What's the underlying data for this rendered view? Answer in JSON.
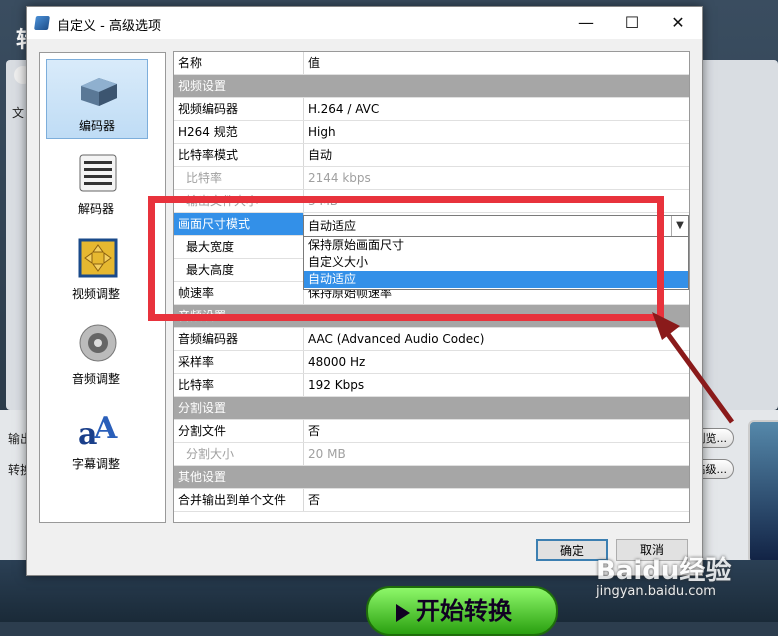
{
  "background": {
    "app_title": "转",
    "label_file": "文",
    "label_output": "输出",
    "label_convert": "转换",
    "browse_label": "浏览...",
    "advanced_label": "高级...",
    "start_label": "开始转换"
  },
  "dialog": {
    "title": "自定义 - 高级选项",
    "minimize": "—",
    "maximize": "☐",
    "close": "✕"
  },
  "nav": [
    {
      "label": "编码器",
      "icon": "encoder-icon",
      "selected": true
    },
    {
      "label": "解码器",
      "icon": "decoder-icon",
      "selected": false
    },
    {
      "label": "视频调整",
      "icon": "video-adjust-icon",
      "selected": false
    },
    {
      "label": "音频调整",
      "icon": "audio-adjust-icon",
      "selected": false
    },
    {
      "label": "字幕调整",
      "icon": "subtitle-adjust-icon",
      "selected": false
    }
  ],
  "grid": {
    "header": {
      "name": "名称",
      "value": "值"
    },
    "rows": [
      {
        "name": "视频设置",
        "value": "",
        "type": "section"
      },
      {
        "name": "视频编码器",
        "value": "H.264 / AVC",
        "type": "normal"
      },
      {
        "name": "H264 规范",
        "value": "High",
        "type": "normal"
      },
      {
        "name": "比特率模式",
        "value": "自动",
        "type": "normal"
      },
      {
        "name": "比特率",
        "value": "2144 kbps",
        "type": "disabled"
      },
      {
        "name": "输出文件大小",
        "value": "3 MB",
        "type": "disabled"
      },
      {
        "name": "画面尺寸模式",
        "value": "自动适应",
        "type": "highlight"
      },
      {
        "name": "最大宽度",
        "value": "",
        "type": "indent"
      },
      {
        "name": "最大高度",
        "value": "",
        "type": "indent"
      },
      {
        "name": "帧速率",
        "value": "保持原始帧速率",
        "type": "normal"
      },
      {
        "name": "音频设置",
        "value": "",
        "type": "section"
      },
      {
        "name": "音频编码器",
        "value": "AAC (Advanced Audio Codec)",
        "type": "normal"
      },
      {
        "name": "采样率",
        "value": "48000 Hz",
        "type": "normal"
      },
      {
        "name": "比特率",
        "value": "192 Kbps",
        "type": "normal"
      },
      {
        "name": "分割设置",
        "value": "",
        "type": "section"
      },
      {
        "name": "分割文件",
        "value": "否",
        "type": "normal"
      },
      {
        "name": "分割大小",
        "value": "20 MB",
        "type": "disabled"
      },
      {
        "name": "其他设置",
        "value": "",
        "type": "section"
      },
      {
        "name": "合并输出到单个文件",
        "value": "否",
        "type": "normal"
      }
    ]
  },
  "dropdown": {
    "selected": "自动适应",
    "options": [
      "保持原始画面尺寸",
      "自定义大小",
      "自动适应"
    ],
    "active_index": 2
  },
  "buttons": {
    "ok": "确定",
    "cancel": "取消"
  },
  "watermark": {
    "main": "Baidu经验",
    "sub": "jingyan.baidu.com"
  },
  "colors": {
    "highlight": "#3390e8",
    "annotation": "#e8323c",
    "section": "#a6a6a6"
  }
}
